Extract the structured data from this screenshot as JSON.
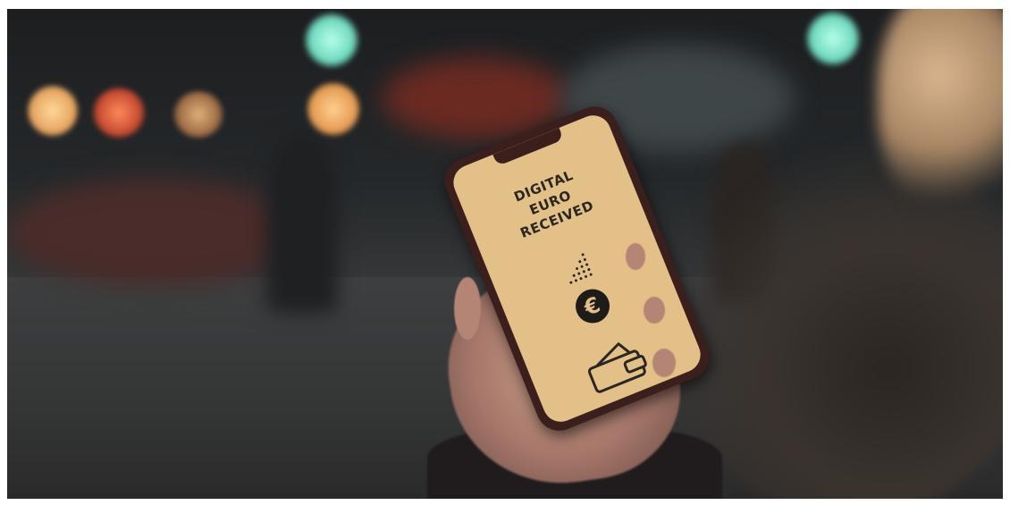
{
  "phone_screen": {
    "line1": "DIGITAL",
    "line2": "EURO",
    "line3": "RECEIVED",
    "currency_symbol": "€"
  },
  "icons": [
    "euro-coin-icon",
    "wallet-icon"
  ],
  "colors": {
    "screen_background": "#e3c088",
    "text": "#2a2622",
    "phone_case": "#3a1f1c",
    "traffic_light": "#7fe0c8",
    "bokeh_warm": "#f3c27a"
  }
}
